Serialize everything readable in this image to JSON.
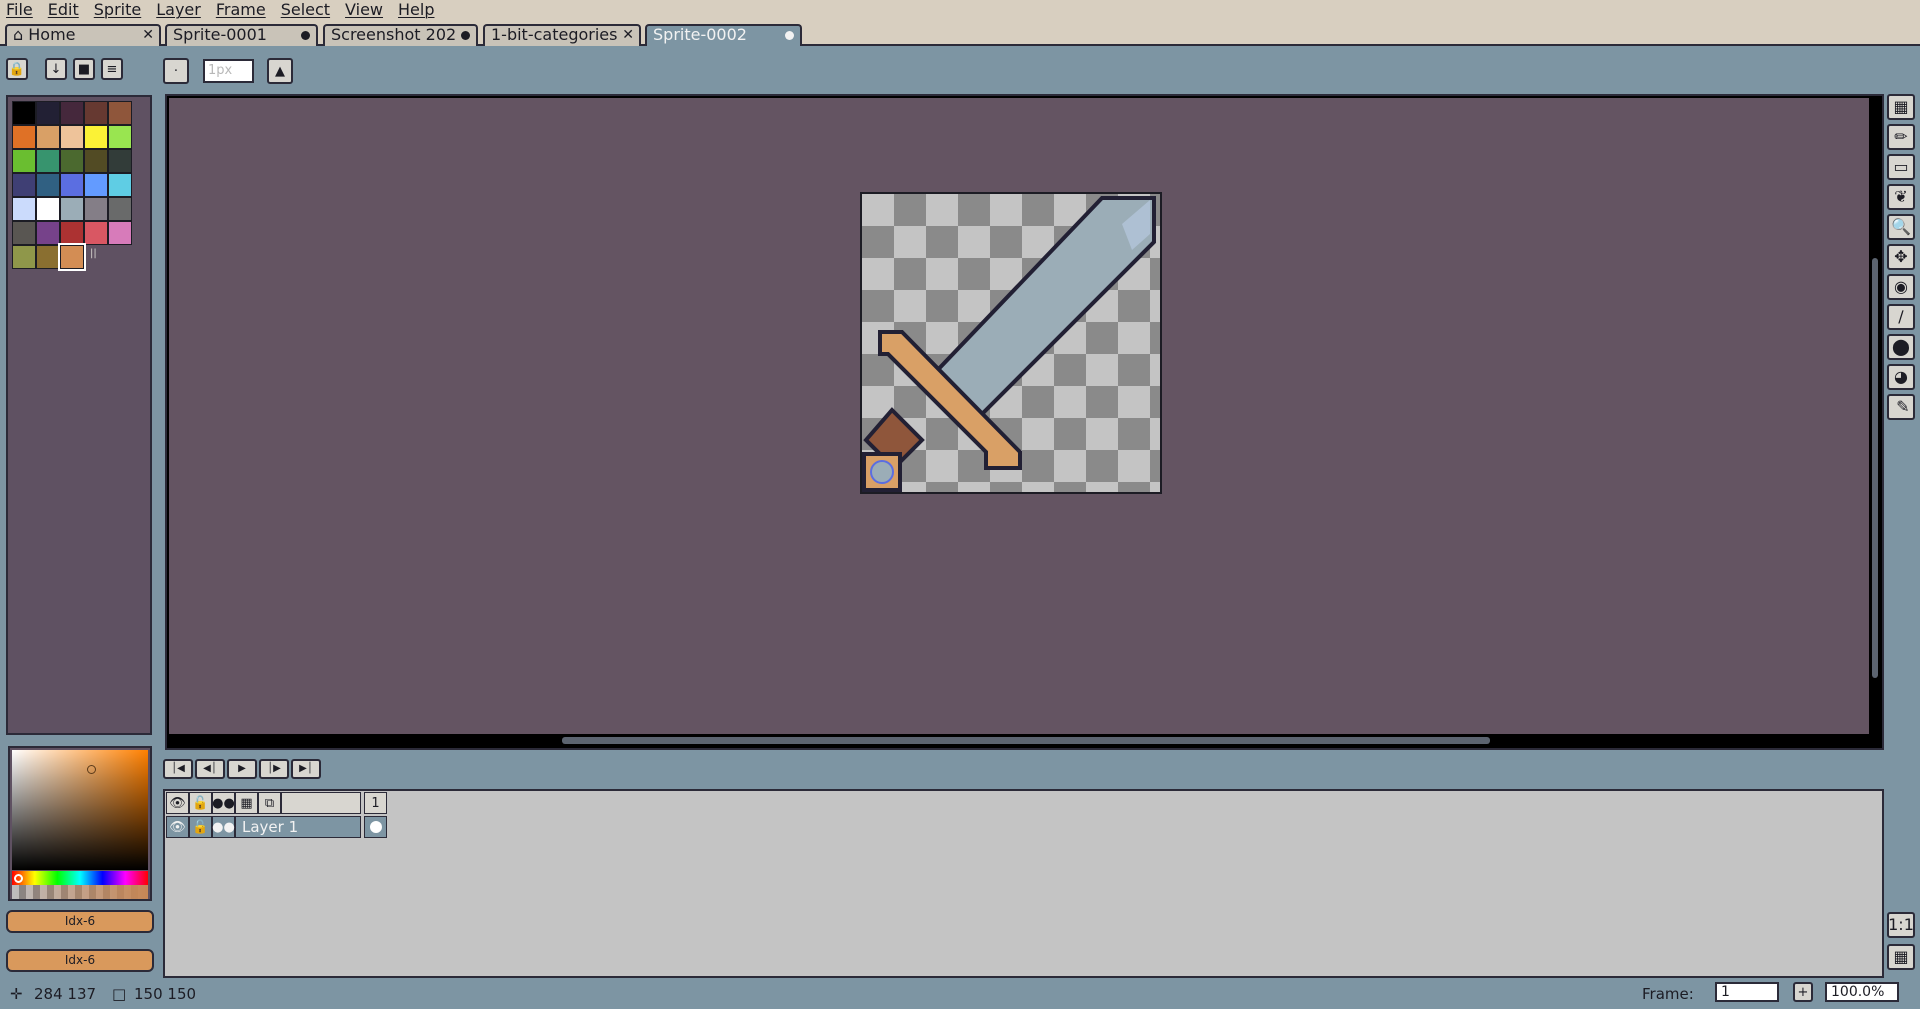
{
  "menu": [
    "File",
    "Edit",
    "Sprite",
    "Layer",
    "Frame",
    "Select",
    "View",
    "Help"
  ],
  "tabs": [
    {
      "label": "Home",
      "state": "close"
    },
    {
      "label": "Sprite-0001",
      "state": "modified"
    },
    {
      "label": "Screenshot 202",
      "state": "modified"
    },
    {
      "label": "1-bit-categories",
      "state": "close"
    },
    {
      "label": "Sprite-0002",
      "state": "modified",
      "active": true
    }
  ],
  "toolbar": {
    "brush_size_placeholder": "1px"
  },
  "palette": [
    "#000000",
    "#222034",
    "#45283c",
    "#663931",
    "#8f563b",
    "#df7126",
    "#d9a066",
    "#eec39a",
    "#fbf236",
    "#99e550",
    "#6abe30",
    "#37946e",
    "#4b692f",
    "#524b24",
    "#323c39",
    "#3f3f74",
    "#306082",
    "#5b6ee1",
    "#639bff",
    "#5fcde4",
    "#cbdbfc",
    "#ffffff",
    "#9badb7",
    "#847e87",
    "#696a6a",
    "#595652",
    "#76428a",
    "#ac3232",
    "#d95763",
    "#d77bba",
    "#8f974a",
    "#8a6f30",
    "#d38d54"
  ],
  "colors": {
    "foreground_label": "Idx-6",
    "background_label": "Idx-6",
    "foreground": "#d38d54",
    "canvas_background": "#645462"
  },
  "timeline": {
    "frame_number": "1",
    "layers": [
      {
        "name": "Layer 1"
      }
    ]
  },
  "status": {
    "cursor_pos": "284 137",
    "sprite_size": "150 150",
    "frame_label": "Frame:",
    "frame_value": "1",
    "zoom": "100.0%"
  }
}
